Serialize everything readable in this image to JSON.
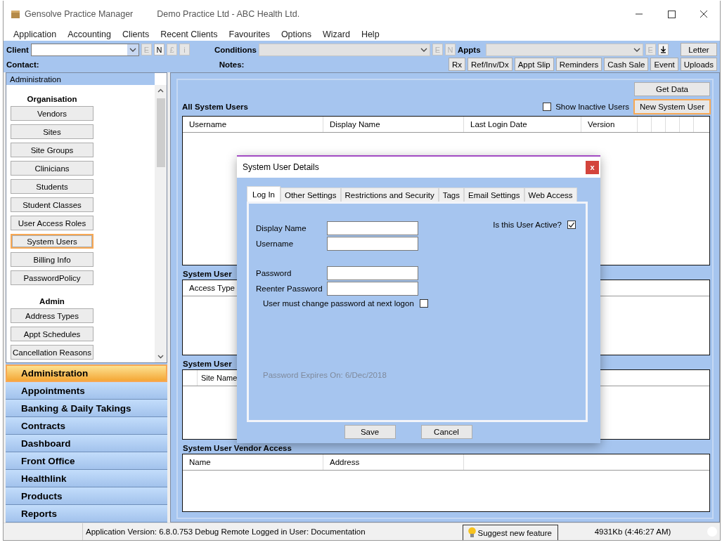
{
  "window": {
    "app_title": "Gensolve Practice Manager",
    "practice_title": "Demo Practice Ltd  - ABC Health Ltd."
  },
  "menu": [
    "Application",
    "Accounting",
    "Clients",
    "Recent Clients",
    "Favourites",
    "Options",
    "Wizard",
    "Help"
  ],
  "toolbar": {
    "client_label": "Client",
    "client_buttons": [
      {
        "label": "E",
        "disabled": true
      },
      {
        "label": "N",
        "disabled": false
      },
      {
        "label": "£",
        "disabled": true
      },
      {
        "label": "i",
        "disabled": true
      }
    ],
    "conditions_label": "Conditions",
    "conditions_buttons": [
      {
        "label": "E",
        "disabled": true
      },
      {
        "label": "N",
        "disabled": true
      }
    ],
    "appts_label": "Appts",
    "appts_buttons": [
      {
        "label": "E",
        "disabled": true
      }
    ],
    "letter_button": "Letter",
    "contact_label": "Contact:",
    "notes_label": "Notes:",
    "action_buttons": [
      "Rx",
      "Ref/Inv/Dx",
      "Appt Slip",
      "Reminders",
      "Cash Sale",
      "Event",
      "Uploads"
    ]
  },
  "sidebar": {
    "header": "Administration",
    "groups": [
      {
        "heading": "Organisation",
        "items": [
          {
            "label": "Vendors",
            "selected": false
          },
          {
            "label": "Sites",
            "selected": false
          },
          {
            "label": "Site Groups",
            "selected": false
          },
          {
            "label": "Clinicians",
            "selected": false
          },
          {
            "label": "Students",
            "selected": false
          },
          {
            "label": "Student Classes",
            "selected": false
          },
          {
            "label": "User Access Roles",
            "selected": false
          },
          {
            "label": "System Users",
            "selected": true
          },
          {
            "label": "Billing Info",
            "selected": false
          },
          {
            "label": "PasswordPolicy",
            "selected": false
          }
        ]
      },
      {
        "heading": "Admin",
        "items": [
          {
            "label": "Address Types",
            "selected": false
          },
          {
            "label": "Appt Schedules",
            "selected": false
          },
          {
            "label": "Cancellation Reasons",
            "selected": false
          }
        ]
      }
    ],
    "nav": [
      {
        "label": "Administration",
        "selected": true
      },
      {
        "label": "Appointments",
        "selected": false
      },
      {
        "label": "Banking & Daily Takings",
        "selected": false
      },
      {
        "label": "Contracts",
        "selected": false
      },
      {
        "label": "Dashboard",
        "selected": false
      },
      {
        "label": "Front Office",
        "selected": false
      },
      {
        "label": "Healthlink",
        "selected": false
      },
      {
        "label": "Products",
        "selected": false
      },
      {
        "label": "Reports",
        "selected": false
      }
    ]
  },
  "content": {
    "get_data_button": "Get Data",
    "show_inactive": {
      "label": "Show Inactive Users",
      "checked": false
    },
    "new_user_button": {
      "label": "New System User",
      "highlighted": true
    },
    "grids": [
      {
        "title": "All System Users",
        "columns": [
          "Username",
          "Display Name",
          "Last Login Date",
          "Version"
        ]
      },
      {
        "title": "System User",
        "columns": [
          "Access Type"
        ]
      },
      {
        "title": "System User",
        "columns": [
          "Site Name"
        ]
      },
      {
        "title": "System User Vendor Access",
        "columns": [
          "Name",
          "Address"
        ]
      }
    ]
  },
  "dialog": {
    "title": "System User Details",
    "close": "x",
    "tabs": [
      {
        "label": "Log In",
        "selected": true
      },
      {
        "label": "Other Settings",
        "selected": false
      },
      {
        "label": "Restrictions and Security",
        "selected": false
      },
      {
        "label": "Tags",
        "selected": false
      },
      {
        "label": "Email Settings",
        "selected": false
      },
      {
        "label": "Web Access",
        "selected": false
      }
    ],
    "fields": [
      {
        "label": "Display Name"
      },
      {
        "label": "Username"
      },
      {
        "label": "Password"
      },
      {
        "label": "Reenter Password"
      }
    ],
    "active": {
      "label": "Is this User Active?",
      "checked": true
    },
    "must_change": {
      "label": "User must change password at next logon",
      "checked": false
    },
    "expires": {
      "text": "Password Expires On: 6/Dec/2018",
      "disabled": true
    },
    "buttons": [
      "Save",
      "Cancel"
    ]
  },
  "status_bar": {
    "version": "Application Version: 6.8.0.753 Debug Remote  Logged in User: Documentation",
    "suggest": "Suggest new feature",
    "memory": "4931Kb  (4:46:27 AM)"
  }
}
